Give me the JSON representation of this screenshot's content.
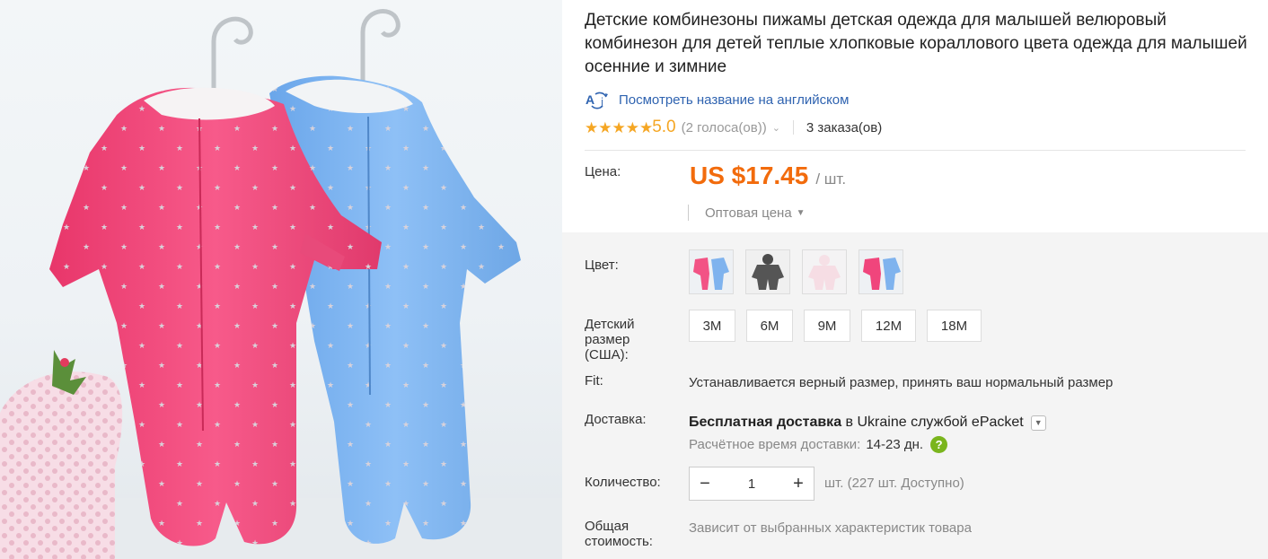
{
  "product": {
    "title": "Детские комбинезоны пижамы детская одежда для малышей велюровый комбинезон для детей теплые хлопковые кораллового цвета одежда для малышей осенние и зимние",
    "translate_link": "Посмотреть название на английском",
    "translate_icon": "translate-icon"
  },
  "rating": {
    "stars": "★★★★★",
    "score": "5.0",
    "votes": "(2 голоса(ов))",
    "orders": "3 заказа(ов)"
  },
  "price": {
    "label": "Цена:",
    "amount": "US $17.45",
    "unit": "/ шт.",
    "wholesale": "Оптовая цена"
  },
  "color": {
    "label": "Цвет:",
    "swatches": [
      "pink-blue",
      "gray",
      "light-pink",
      "pink-blue"
    ]
  },
  "size": {
    "label": "Детский размер (США):",
    "options": [
      "3M",
      "6M",
      "9M",
      "12M",
      "18M"
    ]
  },
  "fit": {
    "label": "Fit:",
    "text": "Устанавливается верный размер, принять ваш нормальный размер"
  },
  "delivery": {
    "label": "Доставка:",
    "free": "Бесплатная доставка",
    "connector": " в ",
    "country": "Ukraine",
    "service_prefix": " службой ",
    "service": "ePacket",
    "estimate_label": "Расчётное время доставки:",
    "estimate_days": "14-23 дн.",
    "help": "?"
  },
  "quantity": {
    "label": "Количество:",
    "minus": "−",
    "plus": "+",
    "value": "1",
    "available": "шт. (227 шт. Доступно)"
  },
  "total": {
    "label": "Общая стоимость:",
    "text": "Зависит от выбранных характеристик товара"
  },
  "colors": {
    "price": "#f26b0c",
    "rating_star": "#f5a623",
    "link": "#2f63b0",
    "help": "#7ab51d"
  }
}
